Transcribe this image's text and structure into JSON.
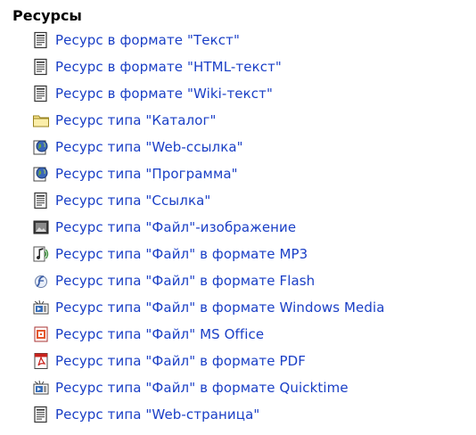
{
  "section": {
    "title": "Ресурсы"
  },
  "colors": {
    "link": "#1a3fc6",
    "heading": "#000000"
  },
  "items": [
    {
      "label": "Ресурс в формате \"Текст\"",
      "icon": "text-document-icon"
    },
    {
      "label": "Ресурс в формате \"HTML-текст\"",
      "icon": "text-document-icon"
    },
    {
      "label": "Ресурс в формате \"Wiki-текст\"",
      "icon": "text-document-icon"
    },
    {
      "label": "Ресурс типа \"Каталог\"",
      "icon": "folder-icon"
    },
    {
      "label": "Ресурс типа \"Web-ссылка\"",
      "icon": "globe-icon"
    },
    {
      "label": "Ресурс типа \"Программа\"",
      "icon": "globe-icon"
    },
    {
      "label": "Ресурс типа \"Ссылка\"",
      "icon": "text-document-icon"
    },
    {
      "label": "Ресурс типа \"Файл\"-изображение",
      "icon": "image-icon"
    },
    {
      "label": "Ресурс типа \"Файл\" в формате MP3",
      "icon": "audio-icon"
    },
    {
      "label": "Ресурс типа \"Файл\" в формате Flash",
      "icon": "flash-icon"
    },
    {
      "label": "Ресурс типа \"Файл\" в формате Windows Media",
      "icon": "video-icon"
    },
    {
      "label": "Ресурс типа \"Файл\" MS Office",
      "icon": "office-icon"
    },
    {
      "label": "Ресурс типа \"Файл\" в формате PDF",
      "icon": "pdf-icon"
    },
    {
      "label": "Ресурс типа \"Файл\" в формате Quicktime",
      "icon": "video-icon"
    },
    {
      "label": "Ресурс типа \"Web-страница\"",
      "icon": "text-document-icon"
    }
  ]
}
